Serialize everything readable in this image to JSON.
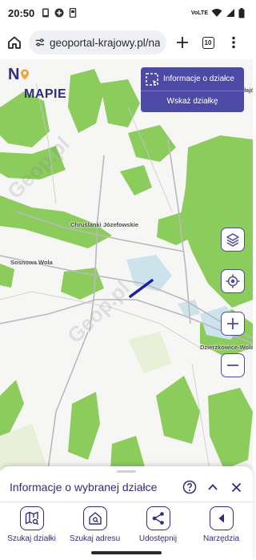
{
  "status_bar": {
    "time": "20:50",
    "network": "VoLTE"
  },
  "browser": {
    "url": "geoportal-krajowy.pl/na-ma",
    "tab_count": "10"
  },
  "map": {
    "logo": {
      "part1": "N",
      "part2": "MAPIE"
    },
    "watermark": "Geop.pl",
    "labels": {
      "chruslanki": "Chruślanki Józefowskie",
      "sosnowa": "Sosnowa Wola",
      "dzierzkowice": "Dzierzkowice-Wola",
      "mikolajowka": "Mikołajówka"
    },
    "info_panel": {
      "info_label": "Informacje o działce",
      "select_label": "Wskaż działkę"
    },
    "colors": {
      "forest": "#8ccc5d",
      "water": "#cde3ec",
      "parcel": "#1e1e9e"
    }
  },
  "bottom_panel": {
    "title": "Informacje o wybranej działce",
    "nav": [
      {
        "label": "Szukaj działki"
      },
      {
        "label": "Szukaj adresu"
      },
      {
        "label": "Udostępnij"
      },
      {
        "label": "Narzędzia"
      }
    ]
  }
}
